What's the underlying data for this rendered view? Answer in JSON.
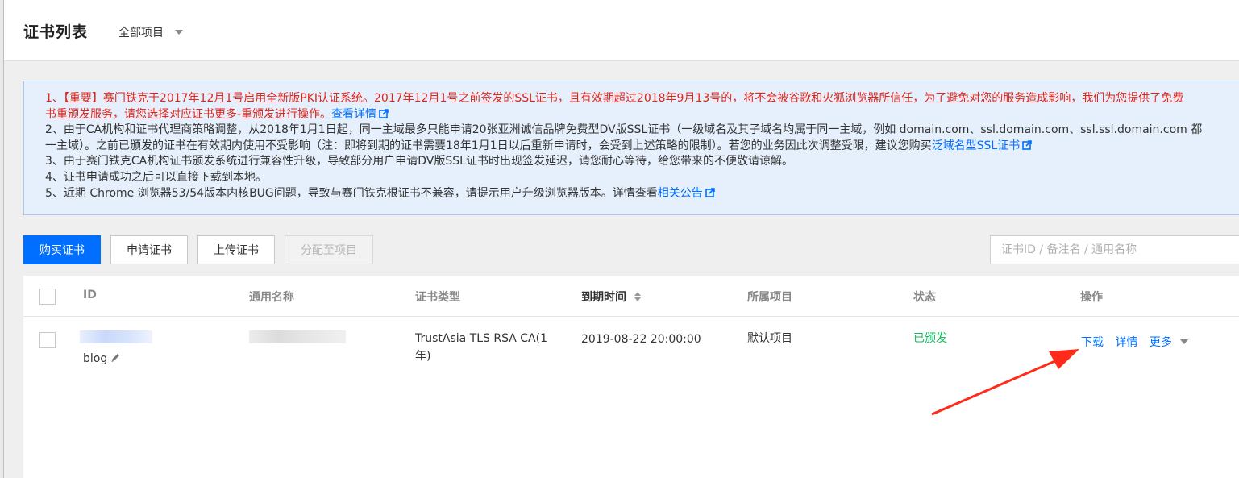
{
  "header": {
    "title": "证书列表",
    "project_selector": "全部项目"
  },
  "notice": {
    "line1": "1、【重要】赛门铁克于2017年12月1号启用全新版PKI认证系统。2017年12月1号之前签发的SSL证书，且有效期超过2018年9月13号的，将不会被谷歌和火狐浏览器所信任，为了避免对您的服务造成影响，我们为您提供了免费",
    "line1b": "书重颁发服务，请您选择对应证书更多-重颁发进行操作。",
    "line1b_link": "查看详情",
    "line2": "2、由于CA机构和证书代理商策略调整，从2018年1月1日起，同一主域最多只能申请20张亚洲诚信品牌免费型DV版SSL证书（一级域名及其子域名均属于同一主域，例如 domain.com、ssl.domain.com、ssl.ssl.domain.com 都",
    "line2b": "一主域）。之前已颁发的证书在有效期内使用不受影响（注：即将到期的证书需要18年1月1日以后重新申请时，会受到上述策略的限制）。若您的业务因此次调整受限，建议您购买",
    "line2b_link": "泛域名型SSL证书",
    "line3": "3、由于赛门铁克CA机构证书颁发系统进行兼容性升级，导致部分用户申请DV版SSL证书时出现签发延迟，请您耐心等待，给您带来的不便敬请谅解。",
    "line4": "4、证书申请成功之后可以直接下载到本地。",
    "line5": "5、近期 Chrome 浏览器53/54版本内核BUG问题，导致与赛门铁克根证书不兼容，请提示用户升级浏览器版本。详情查看",
    "line5_link": "相关公告"
  },
  "toolbar": {
    "buy": "购买证书",
    "apply": "申请证书",
    "upload": "上传证书",
    "assign": "分配至项目"
  },
  "search": {
    "placeholder": "证书ID / 备注名 / 通用名称"
  },
  "table": {
    "headers": {
      "id": "ID",
      "common_name": "通用名称",
      "type": "证书类型",
      "expiry": "到期时间",
      "project": "所属项目",
      "status": "状态",
      "actions": "操作"
    },
    "rows": [
      {
        "remark": "blog",
        "type_line1": "TrustAsia TLS RSA CA(1",
        "type_line2": "年)",
        "expiry": "2019-08-22 20:00:00",
        "project": "默认项目",
        "status": "已颁发",
        "action_download": "下载",
        "action_detail": "详情",
        "action_more": "更多"
      }
    ]
  },
  "colors": {
    "primary": "#006eff",
    "warning": "#e1251b",
    "success": "#0abf5b",
    "annotation_arrow": "#ff2a1a"
  }
}
